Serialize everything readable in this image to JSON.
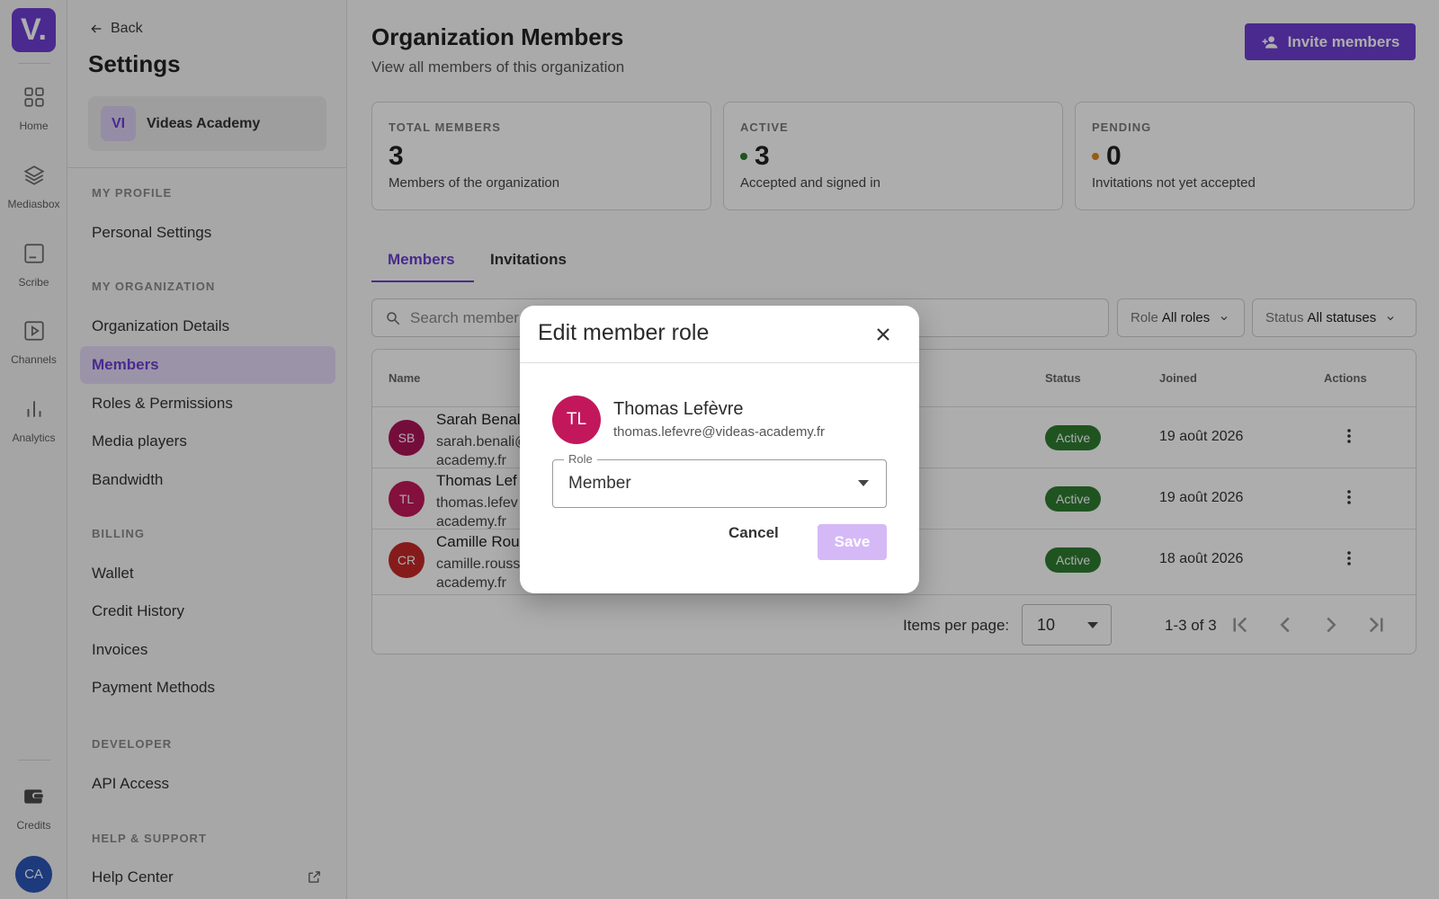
{
  "rail": {
    "logo": "V.",
    "items": [
      {
        "label": "Home",
        "icon": "grid-icon"
      },
      {
        "label": "Mediasbox",
        "icon": "layers-icon"
      },
      {
        "label": "Scribe",
        "icon": "transcript-icon"
      },
      {
        "label": "Channels",
        "icon": "play-square-icon"
      },
      {
        "label": "Analytics",
        "icon": "bar-chart-icon"
      }
    ],
    "credits_label": "Credits",
    "user_initials": "CA"
  },
  "sidebar": {
    "back_label": "Back",
    "title": "Settings",
    "org": {
      "initials": "VI",
      "name": "Videas Academy"
    },
    "sections": {
      "profile": "MY PROFILE",
      "organization": "MY ORGANIZATION",
      "billing": "BILLING",
      "developer": "DEVELOPER",
      "help": "HELP & SUPPORT"
    },
    "items": {
      "personal_settings": "Personal Settings",
      "organization_details": "Organization Details",
      "members": "Members",
      "roles_permissions": "Roles & Permissions",
      "media_players": "Media players",
      "bandwidth": "Bandwidth",
      "wallet": "Wallet",
      "credit_history": "Credit History",
      "invoices": "Invoices",
      "payment_methods": "Payment Methods",
      "api_access": "API Access",
      "help_center": "Help Center"
    }
  },
  "main": {
    "title": "Organization Members",
    "subtitle": "View all members of this organization",
    "invite_label": "Invite members",
    "stats": [
      {
        "label": "TOTAL MEMBERS",
        "value": "3",
        "desc": "Members of the organization",
        "dot": ""
      },
      {
        "label": "ACTIVE",
        "value": "3",
        "desc": "Accepted and signed in",
        "dot": "#2e7d32"
      },
      {
        "label": "PENDING",
        "value": "0",
        "desc": "Invitations not yet accepted",
        "dot": "#e08a1e"
      }
    ],
    "tabs": {
      "members": "Members",
      "invitations": "Invitations"
    },
    "search_placeholder": "Search member",
    "filters": {
      "role_label": "Role",
      "role_value": "All roles",
      "status_label": "Status",
      "status_value": "All statuses"
    },
    "table": {
      "headers": {
        "name": "Name",
        "status": "Status",
        "joined": "Joined",
        "actions": "Actions"
      },
      "rows": [
        {
          "initials": "SB",
          "color": "#ad1457",
          "name": "Sarah Benal",
          "email": "sarah.benali@ academy.fr",
          "status": "Active",
          "joined": "19 août 2026"
        },
        {
          "initials": "TL",
          "color": "#c2185b",
          "name": "Thomas Lef",
          "email": "thomas.lefev academy.fr",
          "status": "Active",
          "joined": "19 août 2026"
        },
        {
          "initials": "CR",
          "color": "#c62828",
          "name": "Camille Rou",
          "email": "camille.rouss academy.fr",
          "status": "Active",
          "joined": "18 août 2026"
        }
      ],
      "pagination": {
        "items_per_page_label": "Items per page:",
        "items_per_page": "10",
        "range": "1-3 of 3"
      }
    }
  },
  "modal": {
    "title": "Edit member role",
    "member": {
      "initials": "TL",
      "name": "Thomas Lefèvre",
      "email": "thomas.lefevre@videas-academy.fr"
    },
    "role_label": "Role",
    "role_value": "Member",
    "cancel_label": "Cancel",
    "save_label": "Save"
  },
  "colors": {
    "accent": "#6d3fd1",
    "active_badge": "#2e7d32",
    "save_disabled": "#d5b9f7"
  }
}
